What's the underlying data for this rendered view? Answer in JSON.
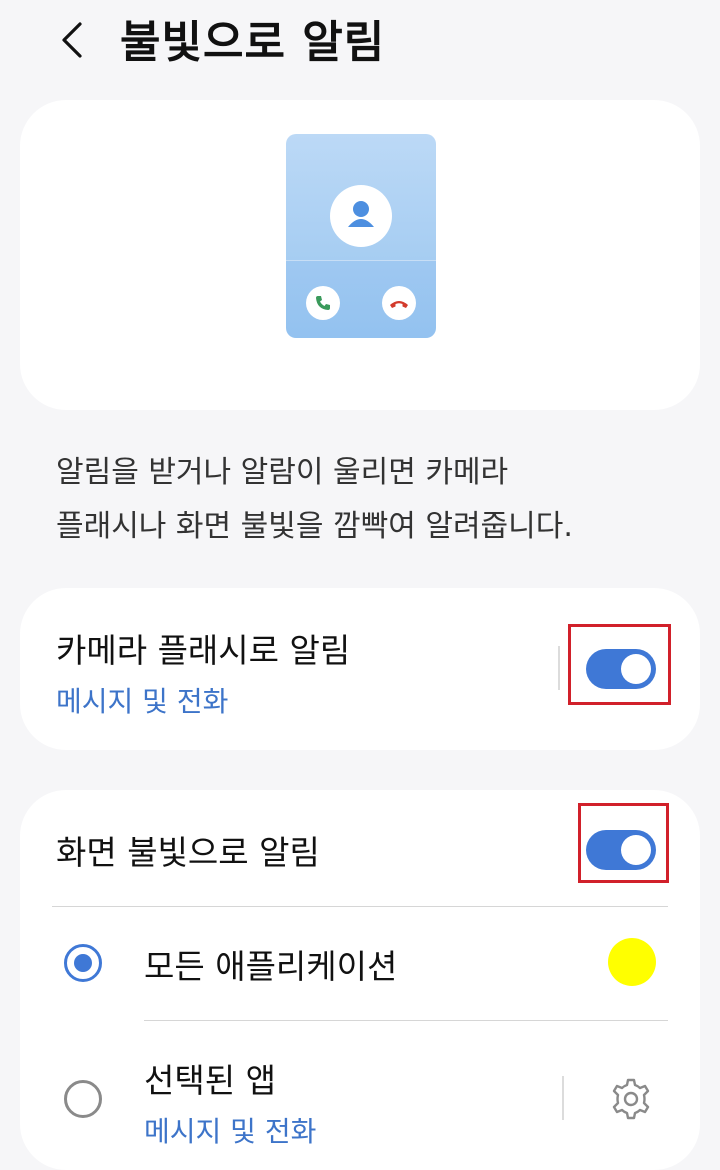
{
  "header": {
    "title": "불빛으로 알림"
  },
  "description": {
    "line1": "알림을 받거나 알람이 울리면 카메라",
    "line2": "플래시나 화면 불빛을 깜빡여 알려줍니다."
  },
  "camera_flash": {
    "title": "카메라 플래시로 알림",
    "subtitle": "메시지 및 전화",
    "enabled": true
  },
  "screen_flash": {
    "title": "화면 불빛으로 알림",
    "enabled": true,
    "options": [
      {
        "label": "모든 애플리케이션",
        "selected": true,
        "color": "#ffff00"
      },
      {
        "label": "선택된 앱",
        "subtitle": "메시지 및 전화",
        "selected": false
      }
    ]
  },
  "colors": {
    "accent": "#3f78d6",
    "highlight": "#d1202a",
    "call_accept": "#3a9a5b",
    "call_decline": "#d33a2c"
  }
}
